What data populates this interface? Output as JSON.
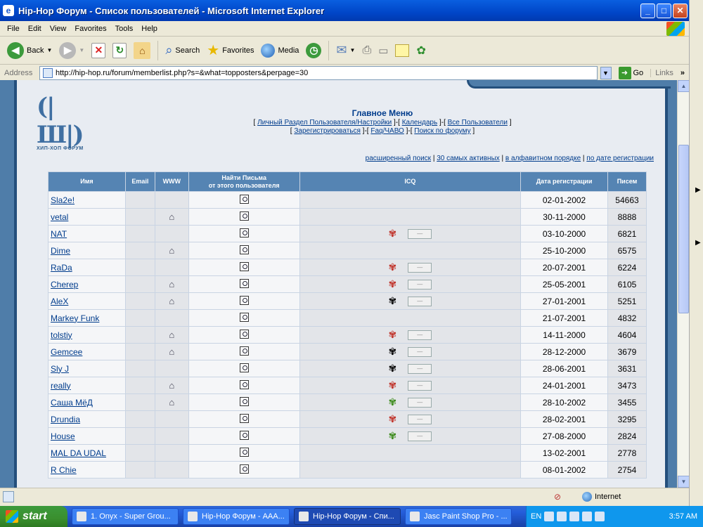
{
  "window": {
    "title": "Hip-Hop Форум - Список пользователей - Microsoft Internet Explorer",
    "icon_glyph": "e"
  },
  "menu": [
    "File",
    "Edit",
    "View",
    "Favorites",
    "Tools",
    "Help"
  ],
  "toolbar": {
    "back": "Back",
    "search": "Search",
    "favorites": "Favorites",
    "media": "Media"
  },
  "address": {
    "label": "Address",
    "url": "http://hip-hop.ru/forum/memberlist.php?s=&what=topposters&perpage=30",
    "go": "Go",
    "links": "Links"
  },
  "page": {
    "logo_text": "ХИП-ХОП ФОРУМ",
    "main_menu": "Главное Меню",
    "nav_row1": [
      "Личный Раздел Пользователя/Настройки",
      "Календарь",
      "Все Пользователи"
    ],
    "nav_row2": [
      "Зарегистрироваться",
      "Faq/ЧАВО",
      "Поиск по форуму"
    ],
    "sort_links": [
      "расширенный поиск",
      "30 самых активных",
      "в алфавитном порядке",
      "по дате регистрации"
    ]
  },
  "table": {
    "headers": {
      "name": "Имя",
      "email": "Email",
      "www": "WWW",
      "find_line1": "Найти Письма",
      "find_line2": "от этого пользователя",
      "icq": "ICQ",
      "regdate": "Дата регистрации",
      "posts": "Писем"
    },
    "rows": [
      {
        "name": "Sla2e!",
        "www": false,
        "icq": "",
        "date": "02-01-2002",
        "posts": "54663"
      },
      {
        "name": "vetal",
        "www": true,
        "icq": "",
        "date": "30-11-2000",
        "posts": "8888"
      },
      {
        "name": "NAT",
        "www": false,
        "icq": "red",
        "date": "03-10-2000",
        "posts": "6821"
      },
      {
        "name": "Dime",
        "www": true,
        "icq": "",
        "date": "25-10-2000",
        "posts": "6575"
      },
      {
        "name": "RaDa",
        "www": false,
        "icq": "red",
        "date": "20-07-2001",
        "posts": "6224"
      },
      {
        "name": "Cherep",
        "www": true,
        "icq": "red",
        "date": "25-05-2001",
        "posts": "6105"
      },
      {
        "name": "AleX",
        "www": true,
        "icq": "gray",
        "date": "27-01-2001",
        "posts": "5251"
      },
      {
        "name": "Markey Funk",
        "www": false,
        "icq": "",
        "date": "21-07-2001",
        "posts": "4832"
      },
      {
        "name": "tolstiy",
        "www": true,
        "icq": "red",
        "date": "14-11-2000",
        "posts": "4604"
      },
      {
        "name": "Gemcee",
        "www": true,
        "icq": "gray",
        "date": "28-12-2000",
        "posts": "3679"
      },
      {
        "name": "Sly J",
        "www": false,
        "icq": "gray",
        "date": "28-06-2001",
        "posts": "3631"
      },
      {
        "name": "really",
        "www": true,
        "icq": "red",
        "date": "24-01-2001",
        "posts": "3473"
      },
      {
        "name": "Саша МёД",
        "www": true,
        "icq": "green",
        "date": "28-10-2002",
        "posts": "3455"
      },
      {
        "name": "Drundia",
        "www": false,
        "icq": "red",
        "date": "28-02-2001",
        "posts": "3295"
      },
      {
        "name": "House",
        "www": false,
        "icq": "green",
        "date": "27-08-2000",
        "posts": "2824"
      },
      {
        "name": "MAL DA UDAL",
        "www": false,
        "icq": "",
        "date": "13-02-2001",
        "posts": "2778"
      },
      {
        "name": "R Chie",
        "www": false,
        "icq": "",
        "date": "08-01-2002",
        "posts": "2754"
      }
    ]
  },
  "status": {
    "zone": "Internet"
  },
  "taskbar": {
    "start": "start",
    "tasks": [
      "1. Onyx - Super Grou...",
      "Hip-Hop Форум - AAA...",
      "Hip-Hop Форум - Спи...",
      "Jasc Paint Shop Pro - ..."
    ],
    "lang": "EN",
    "clock": "3:57 AM"
  }
}
